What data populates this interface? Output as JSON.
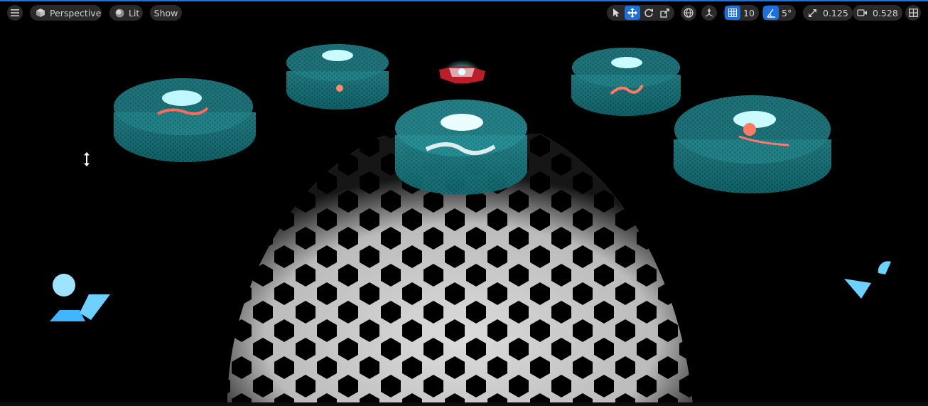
{
  "app": {
    "view_mode": "Perspective",
    "lighting_mode": "Lit",
    "show_menu": "Show"
  },
  "toolbar": {
    "grid_snap_value": "10",
    "rotation_snap_value": "5°",
    "scale_snap_value": "0.125",
    "camera_speed_value": "0.528"
  },
  "icons": {
    "menu": "hamburger-menu-icon",
    "perspective": "cube-icon",
    "lit": "sphere-icon",
    "select": "cursor-arrow-icon",
    "translate": "move-arrows-icon",
    "rotate": "rotate-icon",
    "scale": "scale-icon",
    "world": "globe-icon",
    "surface_snap": "surface-snap-icon",
    "grid": "grid-icon",
    "angle": "angle-icon",
    "scale_snap": "diagonal-arrow-icon",
    "camera": "camera-icon",
    "layout": "viewport-layout-icon",
    "cursor": "vertical-resize-cursor-icon"
  },
  "colors": {
    "accent": "#1e6fd9",
    "toolbar_bg": "#2a2a2a",
    "hologram": "#41e8f0",
    "floor": "#d9d9d9"
  }
}
